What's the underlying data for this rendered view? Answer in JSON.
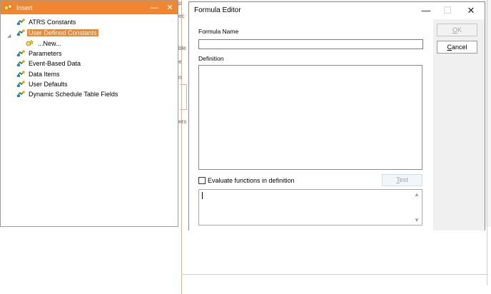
{
  "insert_panel": {
    "title": "Insert",
    "minimize_glyph": "—",
    "close_glyph": "✕",
    "tree": [
      {
        "label": "ATRS Constants",
        "icon": "node-icon"
      },
      {
        "label": "User Defined Constants",
        "icon": "node-icon",
        "selected": true
      },
      {
        "label": "...New...",
        "icon": "new-item-icon"
      },
      {
        "label": "Parameters",
        "icon": "node-icon"
      },
      {
        "label": "Event-Based Data",
        "icon": "node-icon"
      },
      {
        "label": "Data Items",
        "icon": "node-icon"
      },
      {
        "label": "User Defaults",
        "icon": "node-icon"
      },
      {
        "label": "Dynamic Schedule Table Fields",
        "icon": "node-icon"
      }
    ],
    "colors": {
      "title_bar": "#ef8732",
      "selection": "#ef8732"
    }
  },
  "background": {
    "fragments": [
      "p",
      "ec",
      "ble",
      "e",
      "n",
      "ers"
    ]
  },
  "formula_editor": {
    "title": "Formula Editor",
    "minimize_glyph": "—",
    "maximize_glyph": "☐",
    "close_glyph": "✕",
    "formula_name_label": "Formula Name",
    "formula_name_value": "",
    "definition_label": "Definition",
    "definition_value": "",
    "evaluate_label": "Evaluate functions in definition",
    "evaluate_checked": false,
    "test_label_u": "T",
    "test_label_rest": "est",
    "ok_label_u": "O",
    "ok_label_rest": "K",
    "cancel_label_u": "C",
    "cancel_label_rest": "ancel",
    "scroll_up": "▲",
    "scroll_down": "▼"
  }
}
